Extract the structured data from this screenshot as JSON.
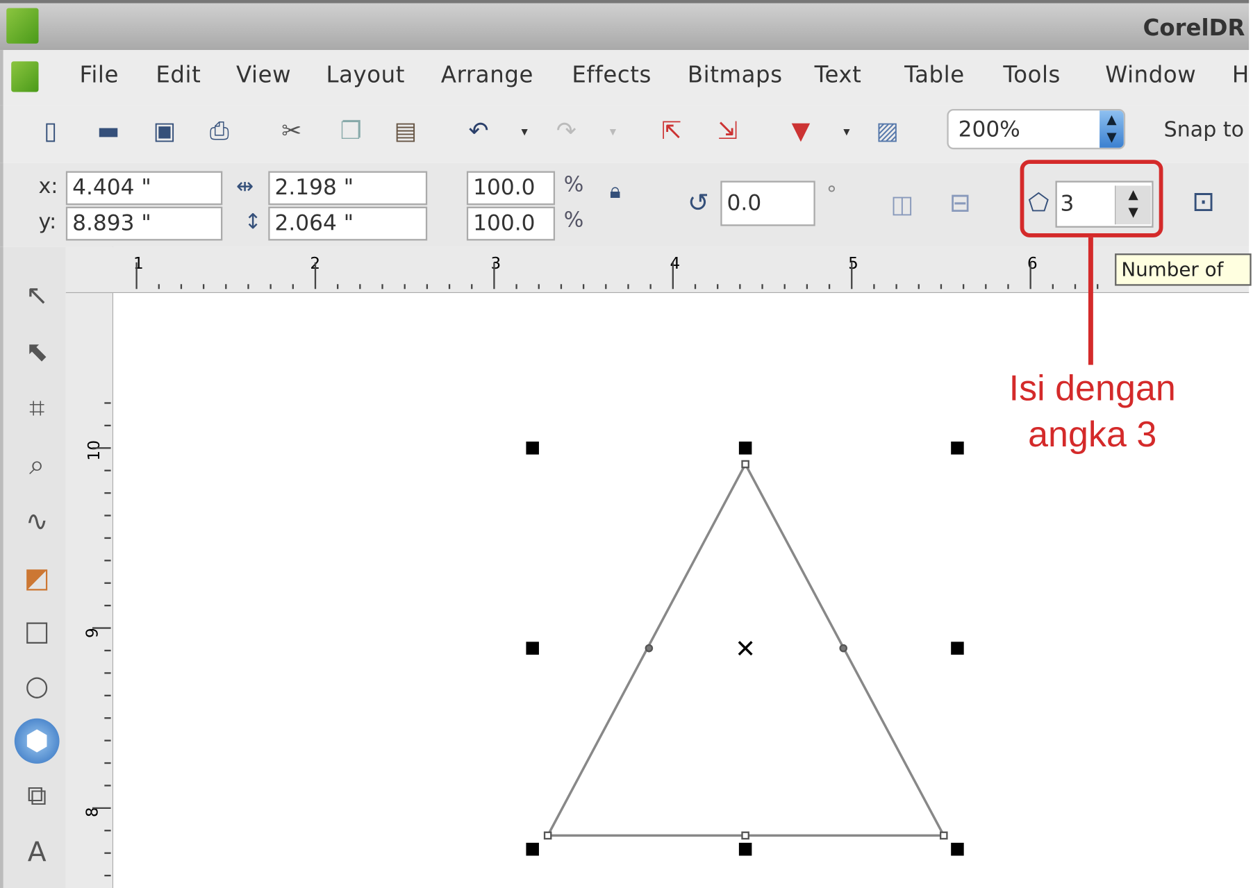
{
  "app": {
    "title": "CorelDR"
  },
  "menu": {
    "items": [
      "File",
      "Edit",
      "View",
      "Layout",
      "Arrange",
      "Effects",
      "Bitmaps",
      "Text",
      "Table",
      "Tools",
      "Window",
      "H"
    ]
  },
  "toolbar": {
    "zoom_value": "200%",
    "snap_label": "Snap to",
    "icons": [
      "new-icon",
      "open-icon",
      "save-icon",
      "print-icon",
      "cut-icon",
      "copy-icon",
      "paste-icon",
      "undo-icon",
      "redo-icon",
      "import-icon",
      "export-icon",
      "publish-pdf-icon",
      "application-launcher-icon"
    ]
  },
  "property_bar": {
    "x_label": "x:",
    "x_value": "4.404 \"",
    "y_label": "y:",
    "y_value": "8.893 \"",
    "width_value": "2.198 \"",
    "height_value": "2.064 \"",
    "scale_x": "100.0",
    "scale_y": "100.0",
    "percent": "%",
    "rotation": "0.0",
    "degree": "°",
    "polygon_points": "3"
  },
  "rulers": {
    "horizontal": [
      "1",
      "2",
      "3",
      "4",
      "5",
      "6"
    ],
    "vertical": [
      "10",
      "9",
      "8"
    ]
  },
  "tooltip": "Number of",
  "annotation": {
    "line1": "Isi dengan",
    "line2": "angka 3",
    "color": "#d42a2a"
  },
  "toolbox": [
    "pick-tool-icon",
    "shape-tool-icon",
    "crop-tool-icon",
    "zoom-tool-icon",
    "freehand-tool-icon",
    "smart-fill-tool-icon",
    "rectangle-tool-icon",
    "ellipse-tool-icon",
    "polygon-tool-icon",
    "basic-shapes-tool-icon",
    "text-tool-icon"
  ]
}
